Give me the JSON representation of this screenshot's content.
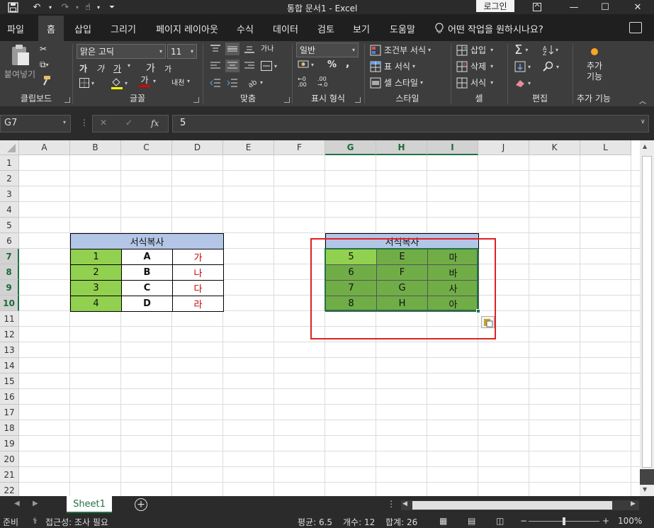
{
  "window": {
    "title": "통합 문서1  -  Excel",
    "login_label": "로그인",
    "qat_icons": [
      "save-icon",
      "undo-icon",
      "redo-icon",
      "touch-icon",
      "customize-icon"
    ]
  },
  "tabs": [
    "파일",
    "홈",
    "삽입",
    "그리기",
    "페이지 레이아웃",
    "수식",
    "데이터",
    "검토",
    "보기",
    "도움말"
  ],
  "active_tab": "홈",
  "tell_me": "어떤 작업을 원하시나요?",
  "ribbon": {
    "clipboard": {
      "label": "클립보드",
      "paste": "붙여넣기"
    },
    "font": {
      "label": "글꼴",
      "font_name": "맑은 고딕",
      "font_size": "11",
      "bold": "가",
      "italic": "가",
      "underline": "가",
      "grow": "가",
      "shrink": "가",
      "font_color_char": "가",
      "phonetic": "내천"
    },
    "alignment": {
      "label": "맞춤",
      "wrap": "가나"
    },
    "number": {
      "label": "표시 형식",
      "format": "일반",
      "percent": "%",
      "comma": ","
    },
    "styles": {
      "label": "스타일",
      "conditional": "조건부 서식",
      "table": "표 서식",
      "cell_style": "셀 스타일"
    },
    "cells": {
      "label": "셀",
      "insert": "삽입",
      "delete": "삭제",
      "format": "서식"
    },
    "editing": {
      "label": "편집"
    },
    "addins": {
      "label": "추가 기능",
      "button_line1": "추가",
      "button_line2": "기능"
    }
  },
  "formula_bar": {
    "name_box": "G7",
    "fx": "fx",
    "value": "5"
  },
  "columns": [
    "A",
    "B",
    "C",
    "D",
    "E",
    "F",
    "G",
    "H",
    "I",
    "J",
    "K",
    "L"
  ],
  "selected_columns": [
    "G",
    "H",
    "I"
  ],
  "rows": [
    "1",
    "2",
    "3",
    "4",
    "5",
    "6",
    "7",
    "8",
    "9",
    "10",
    "11",
    "12",
    "13",
    "14",
    "15",
    "16",
    "17",
    "18",
    "19",
    "20",
    "21",
    "22"
  ],
  "selected_rows": [
    "7",
    "8",
    "9",
    "10"
  ],
  "table_left": {
    "header": "서식복사",
    "rows": [
      [
        "1",
        "A",
        "가"
      ],
      [
        "2",
        "B",
        "나"
      ],
      [
        "3",
        "C",
        "다"
      ],
      [
        "4",
        "D",
        "라"
      ]
    ]
  },
  "table_right": {
    "header": "서식복사",
    "rows": [
      [
        "5",
        "E",
        "마"
      ],
      [
        "6",
        "F",
        "바"
      ],
      [
        "7",
        "G",
        "사"
      ],
      [
        "8",
        "H",
        "아"
      ]
    ]
  },
  "colors": {
    "header_fill": "#b4c6e7",
    "green_light": "#92d050",
    "green_dark": "#70ad47",
    "red_text": "#c00000",
    "highlight_box": "#e02020",
    "excel_green": "#217346"
  },
  "sheet_tab": "Sheet1",
  "status": {
    "ready": "준비",
    "accessibility": "접근성: 조사 필요",
    "average": "평균: 6.5",
    "count": "개수: 12",
    "sum": "합계: 26",
    "zoom": "100%"
  }
}
